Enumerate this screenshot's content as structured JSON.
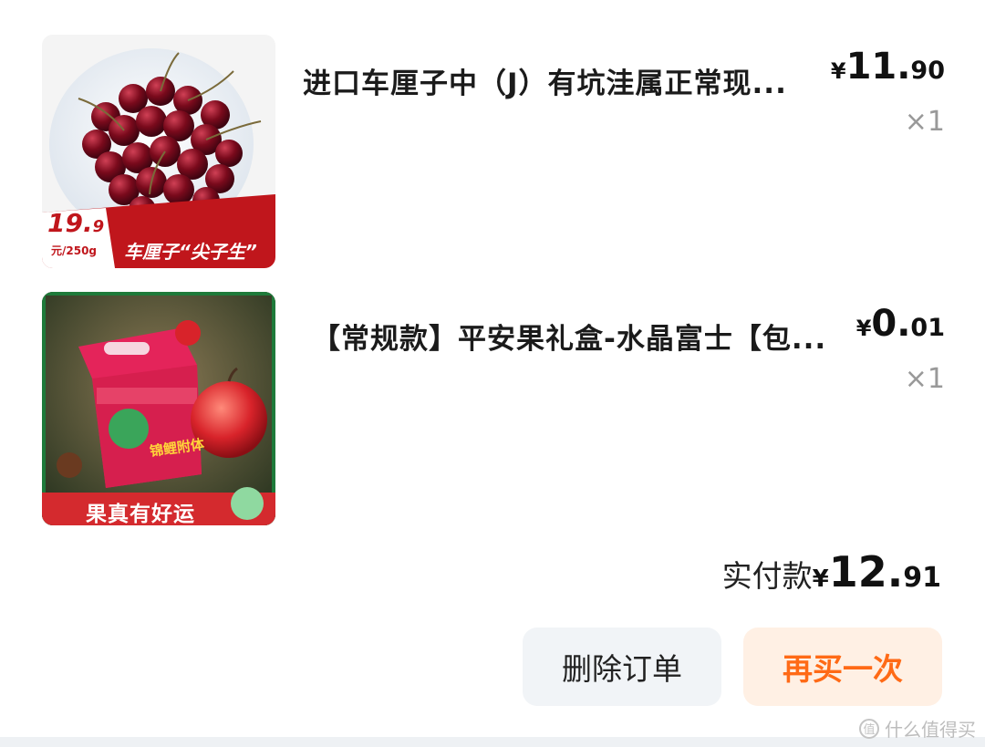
{
  "order": {
    "items": [
      {
        "title": "进口车厘子中（J）有坑洼属正常现...",
        "price": {
          "symbol": "¥",
          "integer": "11.",
          "decimal": "90"
        },
        "quantity": "×1",
        "image": {
          "badge_price_int": "19.",
          "badge_price_dec": "9",
          "badge_unit": "元/250g",
          "banner_text": "车厘子“尖子生”"
        }
      },
      {
        "title": "【常规款】平安果礼盒-水晶富士【包...",
        "price": {
          "symbol": "¥",
          "integer": "0.",
          "decimal": "01"
        },
        "quantity": "×1",
        "image": {
          "banner_text": "果真有好运",
          "box_text": "锦鲤附体"
        }
      }
    ],
    "total": {
      "label": "实付款",
      "symbol": "¥",
      "integer": "12.",
      "decimal": "91"
    },
    "buttons": {
      "delete": "删除订单",
      "rebuy": "再买一次"
    }
  },
  "watermark": {
    "text": "什么值得买",
    "icon": "zhi-logo-icon"
  },
  "colors": {
    "accent": "#ff6a16",
    "rebuy_bg": "#fff0e4",
    "delete_bg": "#f1f4f7",
    "qty_gray": "#999999",
    "cherry_red": "#c0161c"
  }
}
